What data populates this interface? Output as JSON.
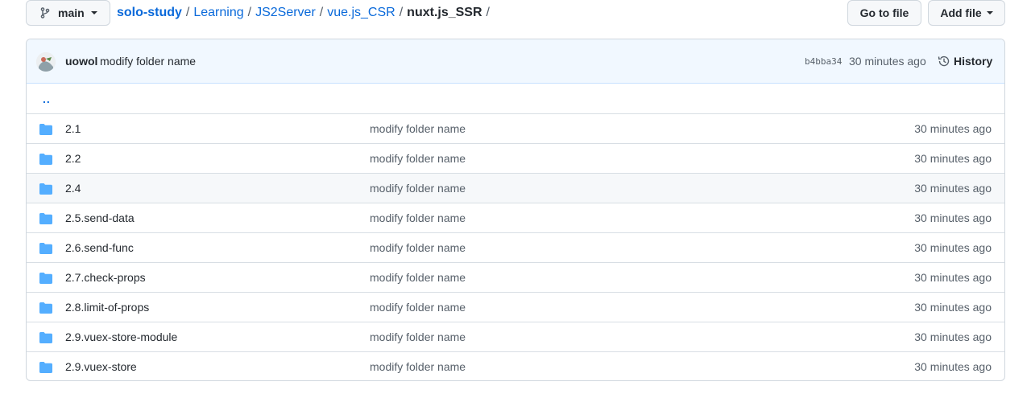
{
  "branch": {
    "label": "main"
  },
  "breadcrumb": {
    "root": "solo-study",
    "parts": [
      "Learning",
      "JS2Server",
      "vue.js_CSR"
    ],
    "current": "nuxt.js_SSR",
    "separator": "/"
  },
  "actions": {
    "goto_file": "Go to file",
    "add_file": "Add file"
  },
  "commit": {
    "author": "uowol",
    "message": "modify folder name",
    "sha": "b4bba34",
    "time": "30 minutes ago",
    "history_label": "History"
  },
  "parent_dir": "..",
  "files": [
    {
      "name": "2.1",
      "message": "modify folder name",
      "time": "30 minutes ago"
    },
    {
      "name": "2.2",
      "message": "modify folder name",
      "time": "30 minutes ago"
    },
    {
      "name": "2.4",
      "message": "modify folder name",
      "time": "30 minutes ago"
    },
    {
      "name": "2.5.send-data",
      "message": "modify folder name",
      "time": "30 minutes ago"
    },
    {
      "name": "2.6.send-func",
      "message": "modify folder name",
      "time": "30 minutes ago"
    },
    {
      "name": "2.7.check-props",
      "message": "modify folder name",
      "time": "30 minutes ago"
    },
    {
      "name": "2.8.limit-of-props",
      "message": "modify folder name",
      "time": "30 minutes ago"
    },
    {
      "name": "2.9.vuex-store-module",
      "message": "modify folder name",
      "time": "30 minutes ago"
    },
    {
      "name": "2.9.vuex-store",
      "message": "modify folder name",
      "time": "30 minutes ago"
    }
  ],
  "colors": {
    "link": "#0969da",
    "folder": "#54aeff",
    "commit_bg": "#f1f8ff",
    "hover_row": "#f6f8fa"
  }
}
